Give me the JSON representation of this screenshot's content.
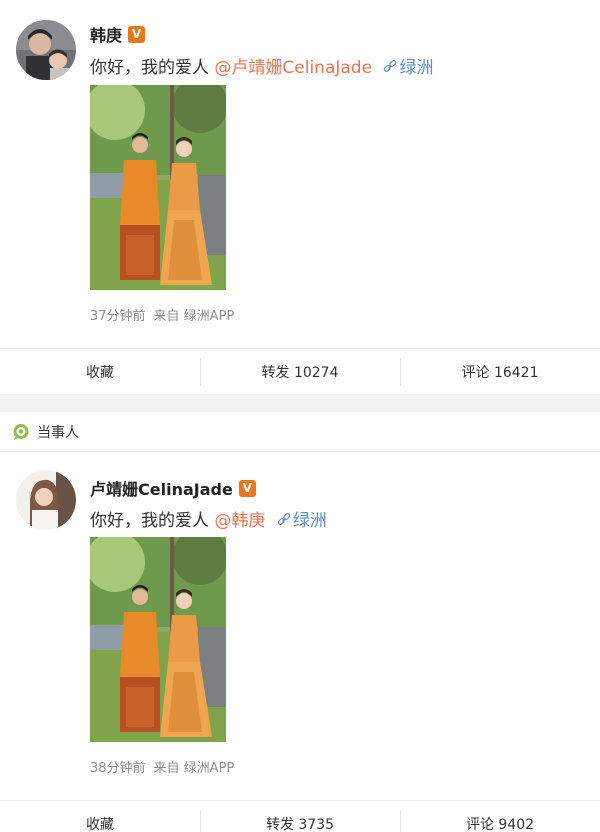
{
  "posts": [
    {
      "username": "韩庚",
      "verified_badge": "V",
      "text": "你好，我的爱人",
      "mention": "@卢靖姗CelinaJade",
      "location": "绿洲",
      "time": "37分钟前",
      "source": "来自 绿洲APP",
      "actions": {
        "favorite": "收藏",
        "repost": "转发 10274",
        "comment": "评论 16421"
      }
    },
    {
      "username": "卢靖姗CelinaJade",
      "verified_badge": "V",
      "text": "你好，我的爱人",
      "mention": "@韩庚",
      "location": "绿洲",
      "time": "38分钟前",
      "source": "来自 绿洲APP",
      "actions": {
        "favorite": "收藏",
        "repost": "转发 3735",
        "comment": "评论 9402"
      }
    }
  ],
  "party_label": "当事人",
  "colors": {
    "mention": "#eb7350",
    "location": "#5d8fc2",
    "verified": "#e8781a",
    "party_icon": "#8bc34a"
  },
  "icons": [
    "link-icon",
    "verified-badge-icon",
    "chat-bubble-icon"
  ]
}
